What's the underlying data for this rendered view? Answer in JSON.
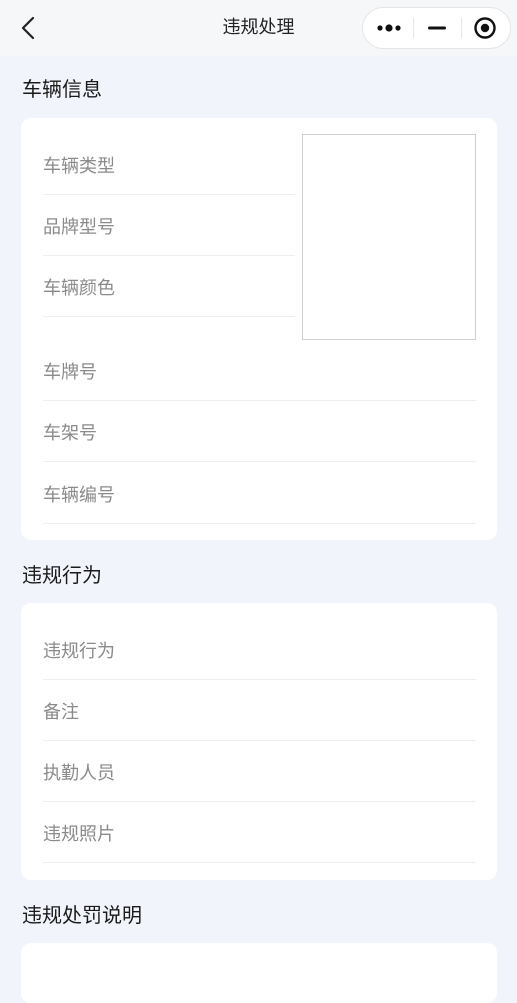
{
  "header": {
    "title": "违规处理",
    "back_icon": "chevron-left-icon",
    "capsule": {
      "more_icon": "more-dots-icon",
      "minimize_icon": "minimize-icon",
      "close_icon": "target-icon"
    }
  },
  "sections": {
    "vehicle": {
      "title": "车辆信息",
      "rows": [
        "车辆类型",
        "品牌型号",
        "车辆颜色",
        "车牌号",
        "车架号",
        "车辆编号"
      ]
    },
    "violation": {
      "title": "违规行为",
      "rows": [
        "违规行为",
        "备注",
        "执勤人员",
        "违规照片"
      ]
    },
    "penalty": {
      "title": "违规处罚说明"
    }
  },
  "colors": {
    "background": "#f1f4fa",
    "card": "#ffffff",
    "label": "#8a8a8a",
    "divider": "#eeeeee"
  }
}
